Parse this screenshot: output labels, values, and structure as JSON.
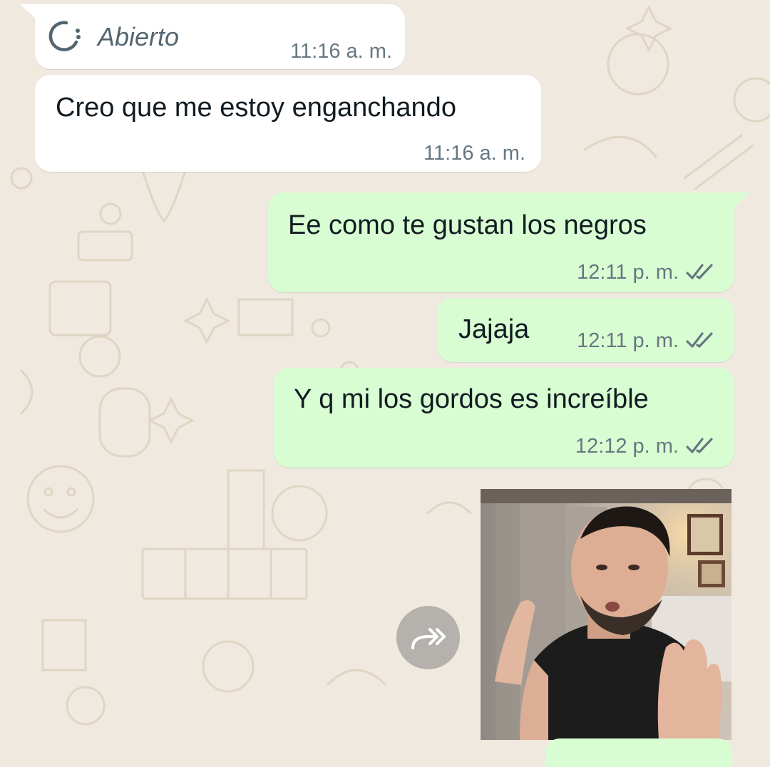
{
  "messages": [
    {
      "direction": "in",
      "text": "Abierto",
      "time": "11:16 a. m.",
      "icon": "pending-circle-icon"
    },
    {
      "direction": "in",
      "text": "Creo que me estoy enganchando",
      "time": "11:16 a. m."
    },
    {
      "direction": "out",
      "text": "Ee como te gustan los negros",
      "time": "12:11 p. m.",
      "status": "double-check-icon"
    },
    {
      "direction": "out",
      "text": "Jajaja",
      "time": "12:11 p. m.",
      "status": "double-check-icon"
    },
    {
      "direction": "out",
      "text": "Y q mi los gordos es increíble",
      "time": "12:12 p. m.",
      "status": "double-check-icon"
    }
  ],
  "media": {
    "type": "image",
    "icon": "photo-thumbnail"
  },
  "forward": {
    "icon": "forward-arrow-icon"
  },
  "colors": {
    "wallpaper": "#efe9df",
    "incoming_bubble": "#ffffff",
    "outgoing_bubble": "#d9fdd3",
    "meta_text": "#667781",
    "tick_color": "#667781"
  }
}
